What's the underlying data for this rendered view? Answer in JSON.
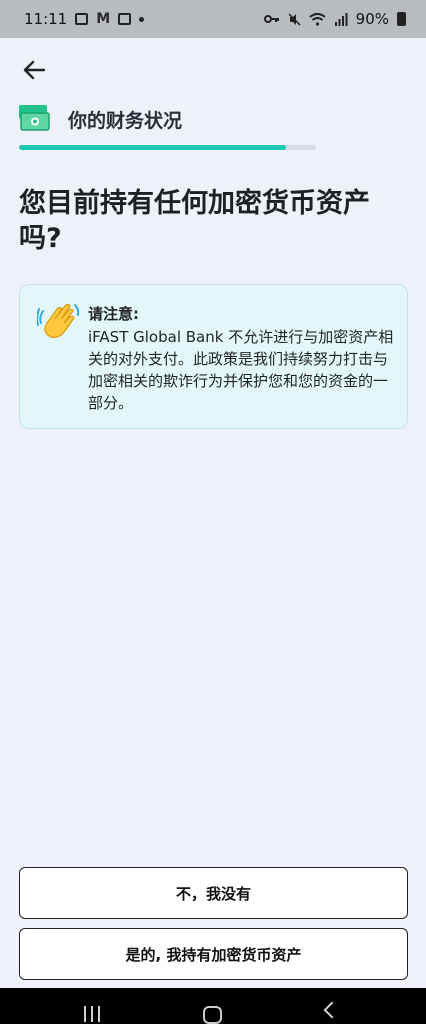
{
  "status_bar": {
    "time": "11:11",
    "battery_text": "90%",
    "icons": [
      "gallery-icon",
      "gmail-icon",
      "check-icon",
      "dot-icon",
      "key-icon",
      "mute-icon",
      "wifi-icon",
      "signal-icon",
      "battery-icon"
    ]
  },
  "header": {
    "back_icon": "arrow-left-icon",
    "section_icon": "money-icon",
    "section_title": "你的财务状况"
  },
  "progress": {
    "fraction": 0.9,
    "color": "#1cc7b3"
  },
  "question": {
    "text": "您目前持有任何加密货币资产吗?"
  },
  "notice": {
    "icon": "waving-hand-icon",
    "heading": "请注意:",
    "body": "iFAST Global Bank 不允许进行与加密资产相关的对外支付。此政策是我们持续努力打击与加密相关的欺诈行为并保护您和您的资金的一部分。",
    "background": "#e3f7f8"
  },
  "options": {
    "no_label": "不，我没有",
    "yes_label": "是的, 我持有加密货币资产"
  },
  "nav_bar": {
    "icons": [
      "recents-icon",
      "home-icon",
      "back-icon"
    ]
  }
}
